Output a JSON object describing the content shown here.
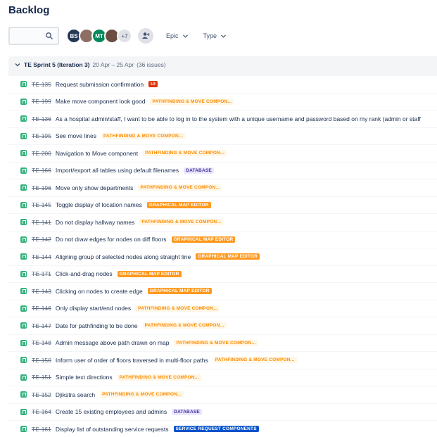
{
  "page": {
    "title": "Backlog"
  },
  "toolbar": {
    "avatars": [
      {
        "initials": "BS",
        "color": "#253858"
      },
      {
        "initials": "",
        "color": "#8d6e63"
      },
      {
        "initials": "MT",
        "color": "#00875a"
      },
      {
        "initials": "",
        "color": "#6d4c41"
      }
    ],
    "more_count": "+7",
    "epic_label": "Epic",
    "type_label": "Type"
  },
  "sprint": {
    "name": "TE Sprint 5 (Iteration 3)",
    "dates": "20 Apr – 25 Apr",
    "count": "(36 issues)"
  },
  "issues": [
    {
      "key": "TE-135",
      "summary": "Request submission confirmation",
      "epic": "UI",
      "epic_style": "ui"
    },
    {
      "key": "TE-199",
      "summary": "Make move component look good",
      "epic": "PATHFINDING & MOVE COMPON...",
      "epic_style": "pathfinding"
    },
    {
      "key": "TE-136",
      "summary": "As a hospital admin/staff, I want to be able to log in to the system with a unique username and password based on my rank (admin or staff",
      "epic": "",
      "epic_style": ""
    },
    {
      "key": "TE-195",
      "summary": "See move lines",
      "epic": "PATHFINDING & MOVE COMPON...",
      "epic_style": "pathfinding"
    },
    {
      "key": "TE-200",
      "summary": "Navigation to Move component",
      "epic": "PATHFINDING & MOVE COMPON...",
      "epic_style": "pathfinding"
    },
    {
      "key": "TE-166",
      "summary": "Import/export all tables using default filenames",
      "epic": "DATABASE",
      "epic_style": "database"
    },
    {
      "key": "TE-196",
      "summary": "Move only show departments",
      "epic": "PATHFINDING & MOVE COMPON...",
      "epic_style": "pathfinding"
    },
    {
      "key": "TE-145",
      "summary": "Toggle display of location names",
      "epic": "GRAPHICAL MAP EDITOR",
      "epic_style": "map"
    },
    {
      "key": "TE-141",
      "summary": "Do not display hallway names",
      "epic": "PATHFINDING & MOVE COMPON...",
      "epic_style": "pathfinding"
    },
    {
      "key": "TE-142",
      "summary": "Do not draw edges for nodes on diff floors",
      "epic": "GRAPHICAL MAP EDITOR",
      "epic_style": "map"
    },
    {
      "key": "TE-144",
      "summary": "Aligning group of selected nodes along straight line",
      "epic": "GRAPHICAL MAP EDITOR",
      "epic_style": "map"
    },
    {
      "key": "TE-171",
      "summary": "Click-and-drag nodes",
      "epic": "GRAPHICAL MAP EDITOR",
      "epic_style": "map"
    },
    {
      "key": "TE-143",
      "summary": "Clicking on nodes to create edge",
      "epic": "GRAPHICAL MAP EDITOR",
      "epic_style": "map"
    },
    {
      "key": "TE-146",
      "summary": "Only display start/end nodes",
      "epic": "PATHFINDING & MOVE COMPON...",
      "epic_style": "pathfinding"
    },
    {
      "key": "TE-147",
      "summary": "Date for pathfinding to be done",
      "epic": "PATHFINDING & MOVE COMPON...",
      "epic_style": "pathfinding"
    },
    {
      "key": "TE-148",
      "summary": "Admin message above path drawn on map",
      "epic": "PATHFINDING & MOVE COMPON...",
      "epic_style": "pathfinding"
    },
    {
      "key": "TE-150",
      "summary": "Inform user of order of floors traversed in multi-floor paths",
      "epic": "PATHFINDING & MOVE COMPON...",
      "epic_style": "pathfinding"
    },
    {
      "key": "TE-151",
      "summary": "Simple text directions",
      "epic": "PATHFINDING & MOVE COMPON...",
      "epic_style": "pathfinding"
    },
    {
      "key": "TE-152",
      "summary": "Djikstra search",
      "epic": "PATHFINDING & MOVE COMPON...",
      "epic_style": "pathfinding"
    },
    {
      "key": "TE-164",
      "summary": "Create 15 existing employees and admins",
      "epic": "DATABASE",
      "epic_style": "database"
    },
    {
      "key": "TE-161",
      "summary": "Display list of outstanding service requests",
      "epic": "SERVICE REQUEST COMPONENTS",
      "epic_style": "service"
    }
  ]
}
